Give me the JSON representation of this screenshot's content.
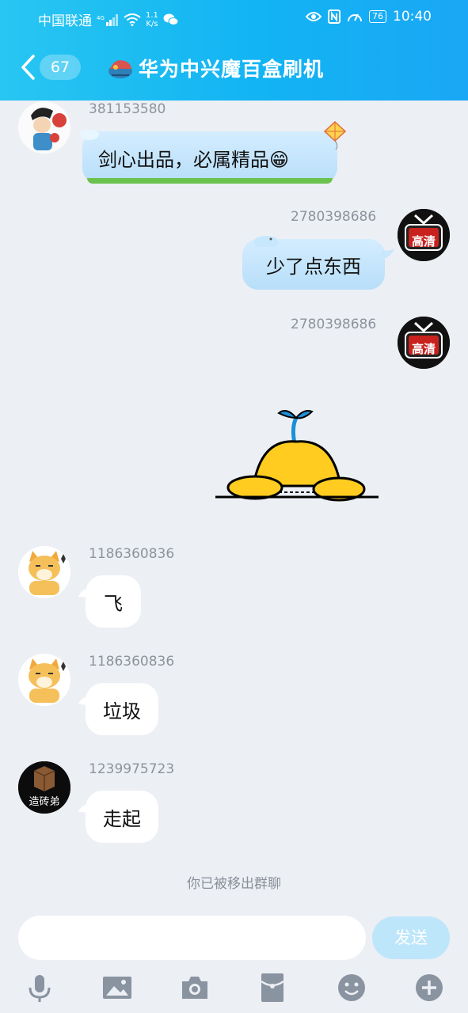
{
  "status_bar": {
    "carrier": "中国联通",
    "net_speed_value": "1.1",
    "net_speed_unit": "K/s",
    "battery": "76",
    "time": "10:40"
  },
  "nav": {
    "unread_count": "67",
    "title": "华为中兴魔百盒刷机"
  },
  "messages": [
    {
      "sender": "381153580",
      "text": "剑心出品，必属精品😁"
    },
    {
      "sender": "2780398686",
      "text": "少了点东西"
    },
    {
      "sender": "2780398686",
      "text": ""
    },
    {
      "sender": "1186360836",
      "text": "飞"
    },
    {
      "sender": "1186360836",
      "text": "垃圾"
    },
    {
      "sender": "1239975723",
      "text": "走起"
    }
  ],
  "avatars": {
    "hd_label": "高清",
    "brick_label": "造砖弟"
  },
  "system_note": "你已被移出群聊",
  "composer": {
    "send_label": "发送"
  },
  "colors": {
    "header_start": "#28c6f2",
    "header_end": "#1aa7f5",
    "bg": "#eceff4"
  }
}
